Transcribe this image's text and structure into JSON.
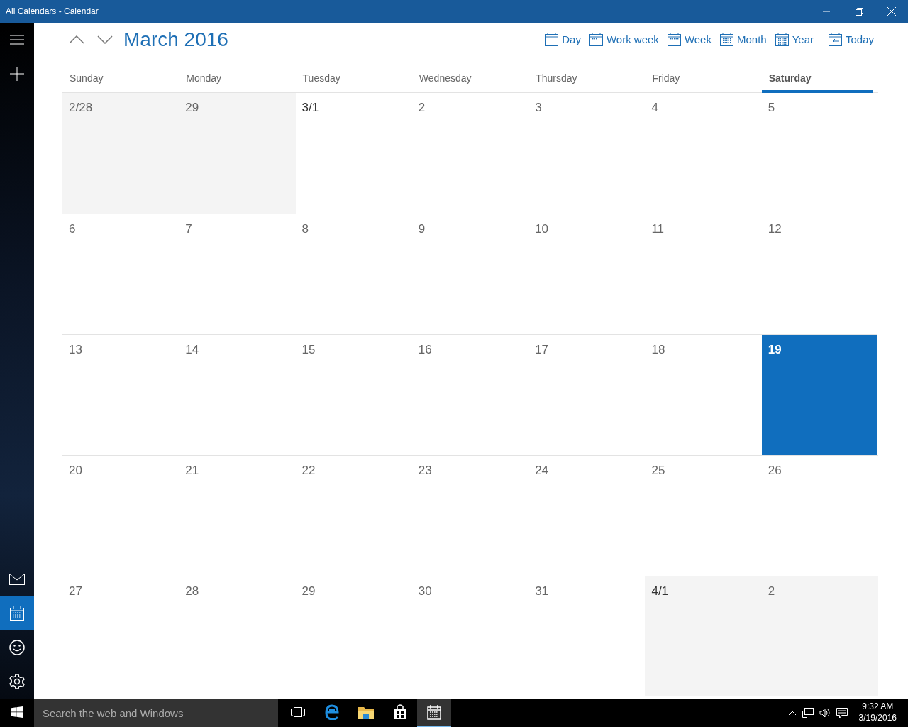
{
  "window": {
    "title": "All Calendars - Calendar"
  },
  "sidebar": {
    "items": [
      {
        "kind": "mail",
        "selected": false
      },
      {
        "kind": "calendar",
        "selected": true
      },
      {
        "kind": "people",
        "selected": false
      },
      {
        "kind": "settings",
        "selected": false
      }
    ]
  },
  "header": {
    "title": "March 2016"
  },
  "views": [
    {
      "label": "Day",
      "kind": "day"
    },
    {
      "label": "Work week",
      "kind": "workweek"
    },
    {
      "label": "Week",
      "kind": "week"
    },
    {
      "label": "Month",
      "kind": "month"
    },
    {
      "label": "Year",
      "kind": "year"
    },
    {
      "label": "Today",
      "kind": "today"
    }
  ],
  "weekdays": [
    {
      "label": "Sunday",
      "selected": false
    },
    {
      "label": "Monday",
      "selected": false
    },
    {
      "label": "Tuesday",
      "selected": false
    },
    {
      "label": "Wednesday",
      "selected": false
    },
    {
      "label": "Thursday",
      "selected": false
    },
    {
      "label": "Friday",
      "selected": false
    },
    {
      "label": "Saturday",
      "selected": true
    }
  ],
  "weeks": [
    [
      {
        "label": "2/28",
        "kind": "adjacent",
        "selected": false
      },
      {
        "label": "29",
        "kind": "adjacent",
        "selected": false
      },
      {
        "label": "3/1",
        "kind": "month_start",
        "selected": false
      },
      {
        "label": "2",
        "kind": "day",
        "selected": false
      },
      {
        "label": "3",
        "kind": "day",
        "selected": false
      },
      {
        "label": "4",
        "kind": "day",
        "selected": false
      },
      {
        "label": "5",
        "kind": "day",
        "selected": false
      }
    ],
    [
      {
        "label": "6",
        "kind": "day",
        "selected": false
      },
      {
        "label": "7",
        "kind": "day",
        "selected": false
      },
      {
        "label": "8",
        "kind": "day",
        "selected": false
      },
      {
        "label": "9",
        "kind": "day",
        "selected": false
      },
      {
        "label": "10",
        "kind": "day",
        "selected": false
      },
      {
        "label": "11",
        "kind": "day",
        "selected": false
      },
      {
        "label": "12",
        "kind": "day",
        "selected": false
      }
    ],
    [
      {
        "label": "13",
        "kind": "day",
        "selected": false
      },
      {
        "label": "14",
        "kind": "day",
        "selected": false
      },
      {
        "label": "15",
        "kind": "day",
        "selected": false
      },
      {
        "label": "16",
        "kind": "day",
        "selected": false
      },
      {
        "label": "17",
        "kind": "day",
        "selected": false
      },
      {
        "label": "18",
        "kind": "day",
        "selected": false
      },
      {
        "label": "19",
        "kind": "day",
        "selected": true
      }
    ],
    [
      {
        "label": "20",
        "kind": "day",
        "selected": false
      },
      {
        "label": "21",
        "kind": "day",
        "selected": false
      },
      {
        "label": "22",
        "kind": "day",
        "selected": false
      },
      {
        "label": "23",
        "kind": "day",
        "selected": false
      },
      {
        "label": "24",
        "kind": "day",
        "selected": false
      },
      {
        "label": "25",
        "kind": "day",
        "selected": false
      },
      {
        "label": "26",
        "kind": "day",
        "selected": false
      }
    ],
    [
      {
        "label": "27",
        "kind": "day",
        "selected": false
      },
      {
        "label": "28",
        "kind": "day",
        "selected": false
      },
      {
        "label": "29",
        "kind": "day",
        "selected": false
      },
      {
        "label": "30",
        "kind": "day",
        "selected": false
      },
      {
        "label": "31",
        "kind": "day",
        "selected": false
      },
      {
        "label": "4/1",
        "kind": "adjacent_month_start",
        "selected": false
      },
      {
        "label": "2",
        "kind": "adjacent",
        "selected": false
      }
    ]
  ],
  "taskbar": {
    "search": {
      "placeholder": "Search the web and Windows"
    },
    "apps": [
      {
        "kind": "taskview",
        "selected": false
      },
      {
        "kind": "browser",
        "selected": false
      },
      {
        "kind": "folder",
        "selected": false
      },
      {
        "kind": "store",
        "selected": false
      },
      {
        "kind": "calendar",
        "selected": true
      }
    ],
    "time": "9:32 AM",
    "date": "3/19/2016"
  }
}
